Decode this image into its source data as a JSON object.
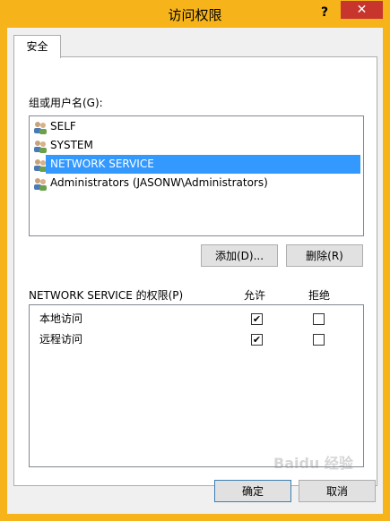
{
  "window": {
    "title": "访问权限",
    "help_glyph": "?",
    "close_glyph": "✕"
  },
  "tabs": [
    {
      "label": "安全"
    }
  ],
  "groups": {
    "label": "组或用户名(G):",
    "items": [
      {
        "name": "SELF",
        "selected": false
      },
      {
        "name": "SYSTEM",
        "selected": false
      },
      {
        "name": "NETWORK SERVICE",
        "selected": true
      },
      {
        "name": "Administrators (JASONW\\Administrators)",
        "selected": false
      }
    ]
  },
  "buttons": {
    "add": "添加(D)...",
    "remove": "删除(R)",
    "ok": "确定",
    "cancel": "取消"
  },
  "permissions": {
    "label": "NETWORK SERVICE 的权限(P)",
    "allow_header": "允许",
    "deny_header": "拒绝",
    "rows": [
      {
        "name": "本地访问",
        "allow": true,
        "deny": false
      },
      {
        "name": "远程访问",
        "allow": true,
        "deny": false
      }
    ]
  },
  "colors": {
    "frame": "#f6b41a",
    "close": "#c7352c",
    "selection": "#3399ff"
  },
  "watermark": "Baidu 经验"
}
